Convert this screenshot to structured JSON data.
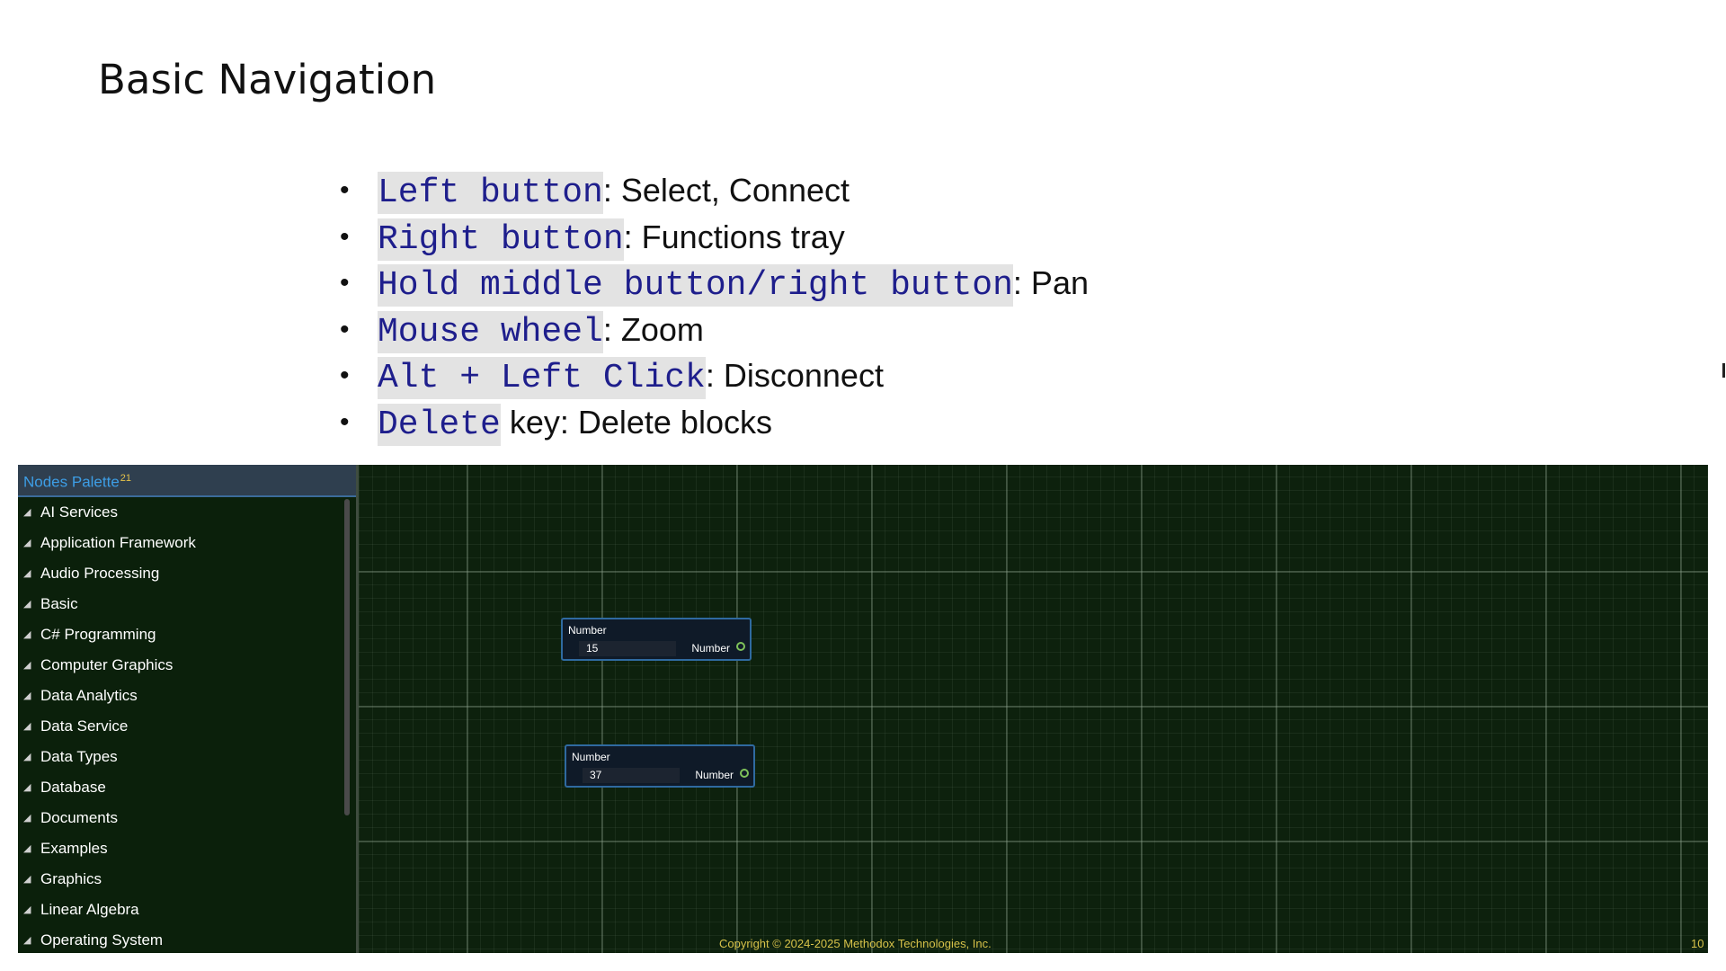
{
  "slide": {
    "title": "Basic Navigation",
    "bullets": [
      {
        "code": "Left button",
        "text": ": Select, Connect"
      },
      {
        "code": "Right button",
        "text": ": Functions tray"
      },
      {
        "code": "Hold middle button/right button",
        "text": ": Pan"
      },
      {
        "code": "Mouse wheel",
        "text": ": Zoom"
      },
      {
        "code": "Alt + Left Click",
        "text": ": Disconnect"
      },
      {
        "code": "Delete",
        "text": " key: Delete blocks"
      }
    ]
  },
  "palette": {
    "title": "Nodes Palette",
    "count": "21",
    "items": [
      {
        "label": "AI Services"
      },
      {
        "label": "Application Framework"
      },
      {
        "label": "Audio Processing"
      },
      {
        "label": "Basic"
      },
      {
        "label": "C# Programming"
      },
      {
        "label": "Computer Graphics"
      },
      {
        "label": "Data Analytics"
      },
      {
        "label": "Data Service"
      },
      {
        "label": "Data Types"
      },
      {
        "label": "Database"
      },
      {
        "label": "Documents"
      },
      {
        "label": "Examples"
      },
      {
        "label": "Graphics"
      },
      {
        "label": "Linear Algebra"
      },
      {
        "label": "Operating System"
      }
    ]
  },
  "nodes": [
    {
      "title": "Number",
      "value": "15",
      "output": "Number"
    },
    {
      "title": "Number",
      "value": "37",
      "output": "Number"
    }
  ],
  "footer": {
    "copyright": "Copyright © 2024-2025 Methodox Technologies, Inc.",
    "page": "10"
  }
}
